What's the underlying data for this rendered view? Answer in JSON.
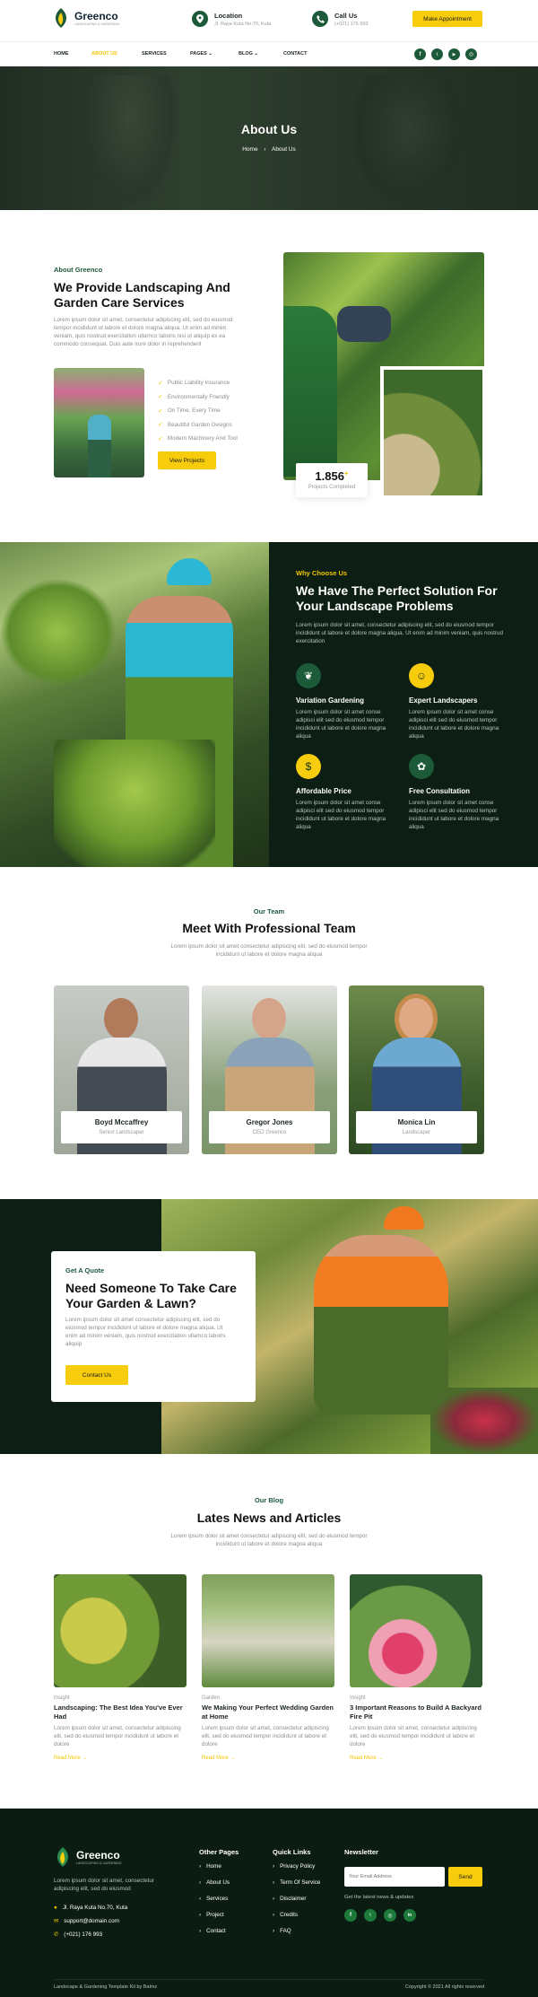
{
  "brand": {
    "name": "Greenco",
    "tagline": "Landscaping & Gardening"
  },
  "header": {
    "location": {
      "label": "Location",
      "value": "Jl. Raya Kuta No.70, Kuta"
    },
    "call": {
      "label": "Call Us",
      "value": "(+021) 176 993"
    },
    "cta": "Make Appointment"
  },
  "nav": {
    "items": [
      "HOME",
      "ABOUT US",
      "SERVICES",
      "PAGES",
      "BLOG",
      "CONTACT"
    ],
    "active": 1,
    "socials": [
      "facebook-icon",
      "twitter-icon",
      "youtube-icon",
      "instagram-icon"
    ]
  },
  "hero": {
    "title": "About Us",
    "crumb_home": "Home",
    "crumb_current": "About Us"
  },
  "about": {
    "eyebrow": "About Greenco",
    "title": "We Provide Landscaping And Garden Care Services",
    "text": "Lorem ipsum dolor sit amet, consectetur adipiscing elit, sed do eiusmod tempor incididunt ut labore et dolore magna aliqua. Ut enim ad minim veniam, quis nostrud exercitation ullamco laboris nisi ut aliquip ex ea commodo consequat. Duis aute irure dolor in reprehenderit",
    "list": [
      "Public Liability Insurance",
      "Environmentally Friendly",
      "On Time, Every Time",
      "Beautiful Garden Designs",
      "Modern Machinery And Tool"
    ],
    "button": "View Projects",
    "stat_value": "1.856",
    "stat_plus": "+",
    "stat_label": "Projects Completed"
  },
  "why": {
    "eyebrow": "Why Choose Us",
    "title": "We Have The Perfect Solution For Your Landscape Problems",
    "text": "Lorem ipsum dolor sit amet, consectetur adipiscing elit, sed do eiusmod tempor incididunt ut labore et dolore magna aliqua. Ut enim ad minim veniam, quis nostrud exercitation",
    "features": [
      {
        "title": "Variation Gardening",
        "text": "Lorem ipsum dolor sit amet conse adipisci elit sed do eiusmod tempor incididunt ut labore et dolore magna aliqua",
        "icon": "leaf-icon",
        "color": "#1d5a3a"
      },
      {
        "title": "Expert Landscapers",
        "text": "Lorem ipsum dolor sit amet conse adipisci elit sed do eiusmod tempor incididunt ut labore et dolore magna aliqua",
        "icon": "person-icon",
        "color": "#f6cc0c"
      },
      {
        "title": "Affordable Price",
        "text": "Lorem ipsum dolor sit amet conse adipisci elit sed do eiusmod tempor incididunt ut labore et dolore magna aliqua",
        "icon": "price-icon",
        "color": "#f6cc0c"
      },
      {
        "title": "Free Consultation",
        "text": "Lorem ipsum dolor sit amet conse adipisci elit sed do eiusmod tempor incididunt ut labore et dolore magna aliqua",
        "icon": "consult-icon",
        "color": "#1d5a3a"
      }
    ]
  },
  "team": {
    "eyebrow": "Our Team",
    "title": "Meet With Professional Team",
    "text": "Lorem ipsum dolor sit amet consectetur adipiscing elit, sed do eiusmod tempor incididunt ut labore et dolore magna aliqua",
    "members": [
      {
        "name": "Boyd Mccaffrey",
        "role": "Senior Landscaper"
      },
      {
        "name": "Gregor Jones",
        "role": "CEO Greenco"
      },
      {
        "name": "Monica Lin",
        "role": "Landscaper"
      }
    ]
  },
  "quote": {
    "eyebrow": "Get A Quote",
    "title": "Need Someone To Take Care Your Garden & Lawn?",
    "text": "Lorem ipsum dolor sit amet consectetur adipiscing elit, sed do eiusmod tempor incididunt ut labore et dolore magna aliqua. Ut enim ad minim veniam, quis nostrud exercitation ullamco laboris aliquip",
    "button": "Contact Us"
  },
  "blog": {
    "eyebrow": "Our Blog",
    "title": "Lates News and Articles",
    "text": "Lorem ipsum dolor sit amet consectetur adipiscing elit, sed do eiusmod tempor incididunt ut labore et dolore magna aliqua",
    "posts": [
      {
        "cat": "Insight",
        "title": "Landscaping: The Best Idea You've Ever Had",
        "text": "Lorem ipsum dolor sit amet, consectetur adipiscing elit, sed do eiusmod tempor incididunt ut labore et dolore",
        "more": "Read More"
      },
      {
        "cat": "Garden",
        "title": "We Making Your Perfect Wedding Garden at Home",
        "text": "Lorem ipsum dolor sit amet, consectetur adipiscing elit, sed do eiusmod tempor incididunt ut labore et dolore",
        "more": "Read More"
      },
      {
        "cat": "Insight",
        "title": "3 Important Reasons to Build A Backyard Fire Pit",
        "text": "Lorem ipsum dolor sit amet, consectetur adipiscing elit, sed do eiusmod tempor incididunt ut labore et dolore",
        "more": "Read More"
      }
    ]
  },
  "footer": {
    "about": "Lorem ipsum dolor sit amet, consectetur adipiscing elit, sed do eiusmod",
    "address": "Jl. Raya Kuta No.70, Kuta",
    "email": "support@domain.com",
    "phone": "(+021) 176 993",
    "col1": {
      "title": "Other Pages",
      "links": [
        "Home",
        "About Us",
        "Services",
        "Project",
        "Contact"
      ]
    },
    "col2": {
      "title": "Quick Links",
      "links": [
        "Privacy Policy",
        "Term Of Service",
        "Disclaimer",
        "Credits",
        "FAQ"
      ]
    },
    "newsletter": {
      "title": "Newsletter",
      "placeholder": "Your Email Address",
      "button": "Send",
      "note": "Get the latest news & updates"
    },
    "bottom_left": "Landscape & Gardening Template Kit by Balmz",
    "bottom_right": "Copyright © 2021 All rights reserved"
  }
}
